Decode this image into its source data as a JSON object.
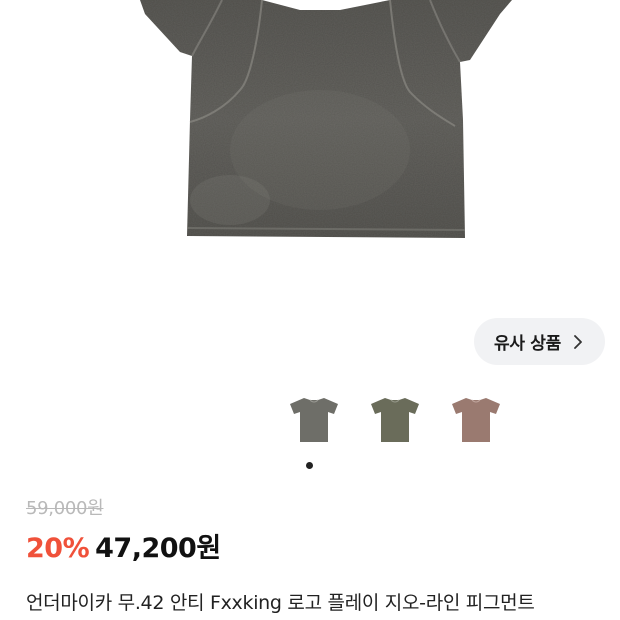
{
  "similar_button": {
    "label": "유사 상품",
    "icon": "chevron-right-icon"
  },
  "gallery": {
    "thumbnails": [
      {
        "color": "#6e6e68",
        "label": "charcoal"
      },
      {
        "color": "#6a6c5a",
        "label": "olive"
      },
      {
        "color": "#9a7a70",
        "label": "pink-brown"
      }
    ],
    "page_indicator": {
      "current": 1
    }
  },
  "price": {
    "original": "59,000원",
    "discount_rate": "20%",
    "final": "47,200원"
  },
  "product": {
    "name": "언더마이카 무.42 안티 Fxxking 로고 플레이 지오-라인 피그먼트"
  },
  "colors": {
    "discount": "#f0513a",
    "button_bg": "#f1f2f4"
  }
}
